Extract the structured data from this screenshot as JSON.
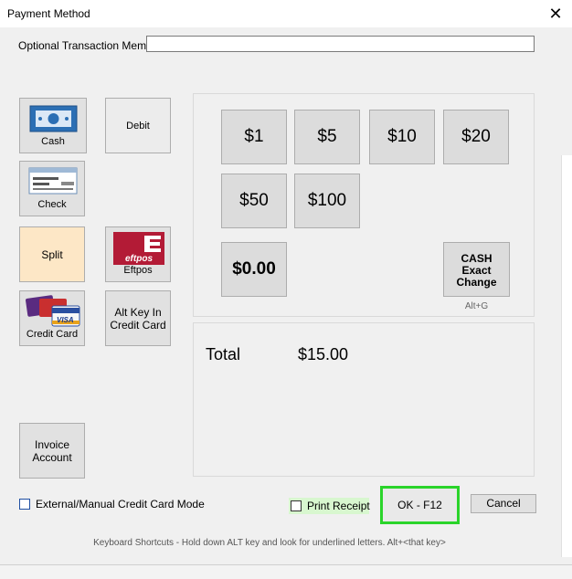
{
  "window": {
    "title": "Payment Method",
    "close_label": "✕"
  },
  "memo": {
    "label": "Optional Transaction Memo",
    "value": ""
  },
  "methods": {
    "cash": "Cash",
    "debit": "Debit",
    "check": "Check",
    "split": "Split",
    "eftpos": "Eftpos",
    "eftpos_logo": "eftpos",
    "credit_card": "Credit Card",
    "alt_key_in_1": "Alt Key In",
    "alt_key_in_2": "Credit Card",
    "invoice_1": "Invoice",
    "invoice_2": "Account",
    "visa_text": "VISA"
  },
  "denominations": [
    "$1",
    "$5",
    "$10",
    "$20",
    "$50",
    "$100",
    "$0.00"
  ],
  "cash_exact": {
    "line1": "CASH",
    "line2": "Exact",
    "line3": "Change",
    "shortcut": "Alt+G"
  },
  "total": {
    "label": "Total",
    "value": "$15.00"
  },
  "options": {
    "manual_cc": "External/Manual Credit Card Mode",
    "print_receipt": "Print Receipt"
  },
  "buttons": {
    "ok": "OK - F12",
    "cancel": "Cancel"
  },
  "footer": {
    "shortcuts": "Keyboard Shortcuts - Hold down ALT key and look for underlined letters.   Alt+<that key>"
  },
  "colors": {
    "ok_highlight": "#2ad42a",
    "split_bg": "#fde7c6",
    "print_bg": "#d8f7cf",
    "eftpos_red": "#b31b36",
    "cash_blue": "#2c6fb4"
  }
}
